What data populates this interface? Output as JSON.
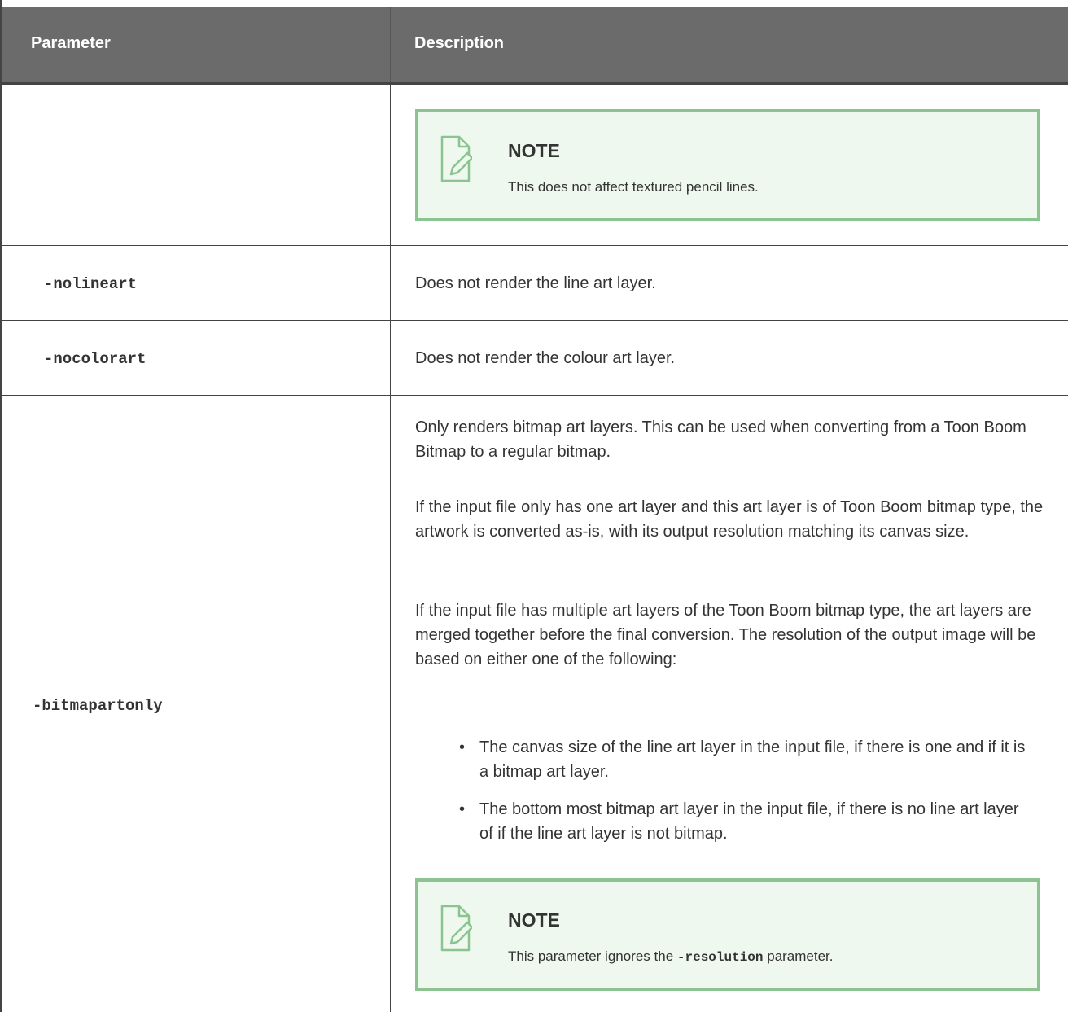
{
  "header": {
    "col1": "Parameter",
    "col2": "Description"
  },
  "rows": [
    {
      "param": "",
      "note": {
        "title": "NOTE",
        "text": "This does not affect textured pencil lines."
      }
    },
    {
      "param": "-nolineart",
      "desc": "Does not render the line art layer."
    },
    {
      "param": "-nocolorart",
      "desc": "Does not render the colour art layer."
    },
    {
      "param": "-bitmapartonly",
      "paragraphs": [
        "Only renders bitmap art layers. This can be used when converting from a Toon Boom Bitmap to a regular bitmap.",
        "If the input file only has one art layer and this art layer is of Toon Boom bitmap type, the artwork is converted as-is, with its output resolution matching its canvas size.",
        "If the input file has multiple art layers of the Toon Boom bitmap type, the art layers are merged together before the final conversion. The resolution of the output image will be based on either one of the following:"
      ],
      "bullets": [
        "The canvas size of the line art layer in the input file, if there is one and if it is a bitmap art layer.",
        "The bottom most bitmap art layer in the input file, if there is no line art layer of if the line art layer is not bitmap."
      ],
      "note": {
        "title": "NOTE",
        "text_before": "This parameter ignores the ",
        "code": "-resolution",
        "text_after": " parameter."
      }
    }
  ],
  "icon": "note-pencil-icon"
}
